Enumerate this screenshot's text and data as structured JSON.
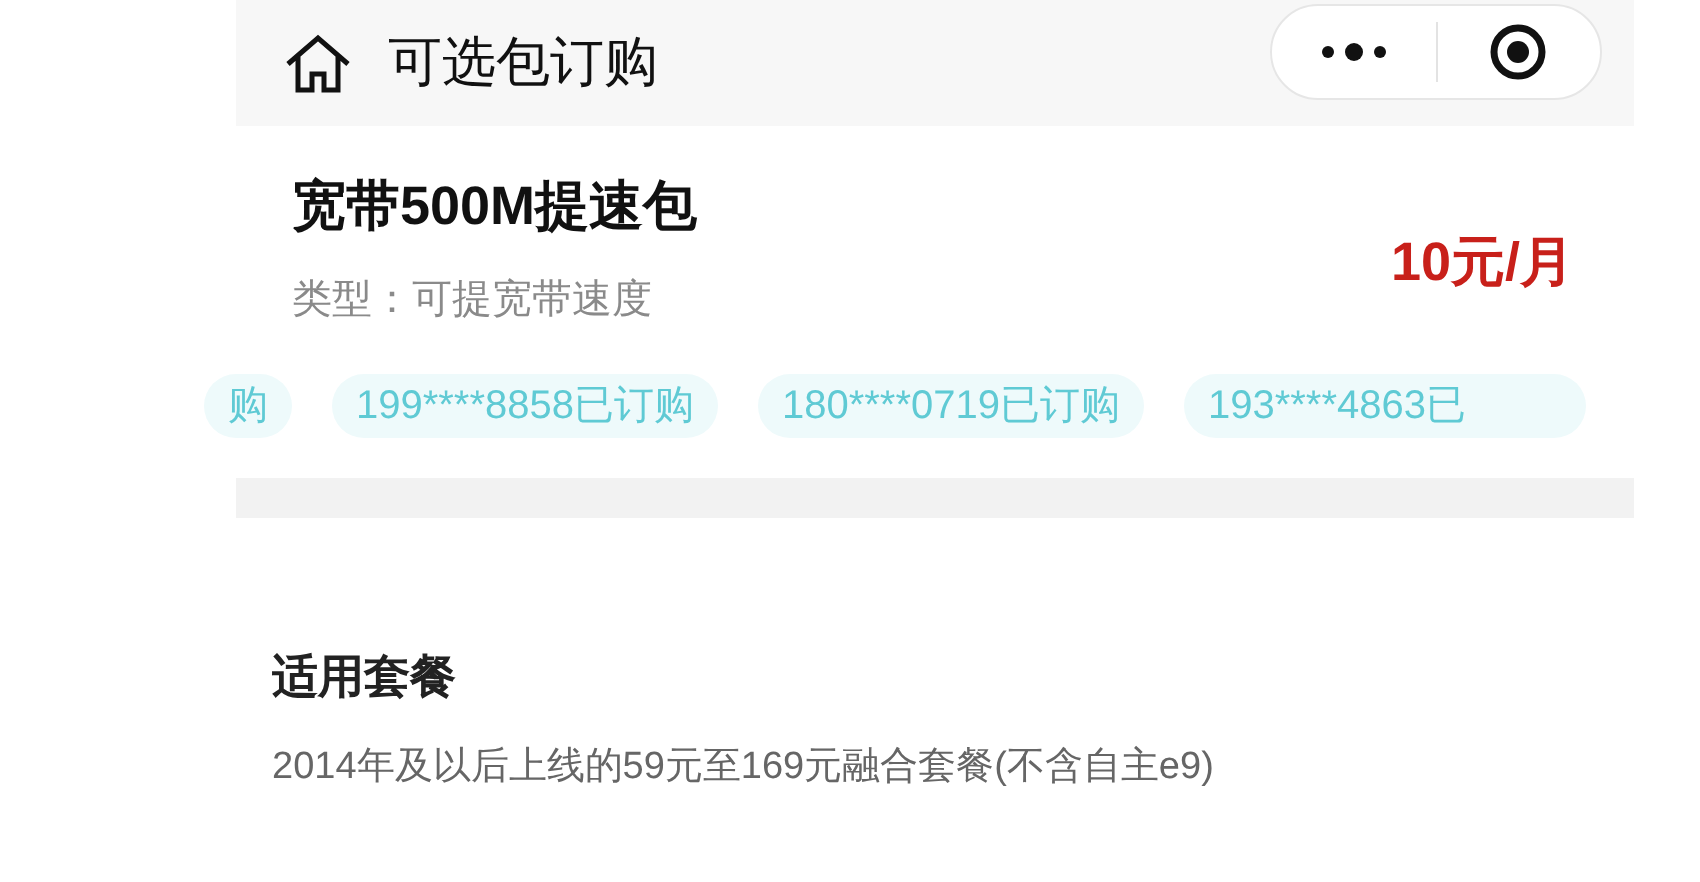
{
  "header": {
    "title": "可选包订购"
  },
  "product": {
    "name": "宽带500M提速包",
    "type_line": "类型：可提宽带速度",
    "price": "10元/月"
  },
  "ticker": [
    "购",
    "199****8858已订购",
    "180****0719已订购",
    "193****4863已"
  ],
  "plan_section": {
    "heading": "适用套餐",
    "description": "2014年及以后上线的59元至169元融合套餐(不含自主e9)"
  }
}
